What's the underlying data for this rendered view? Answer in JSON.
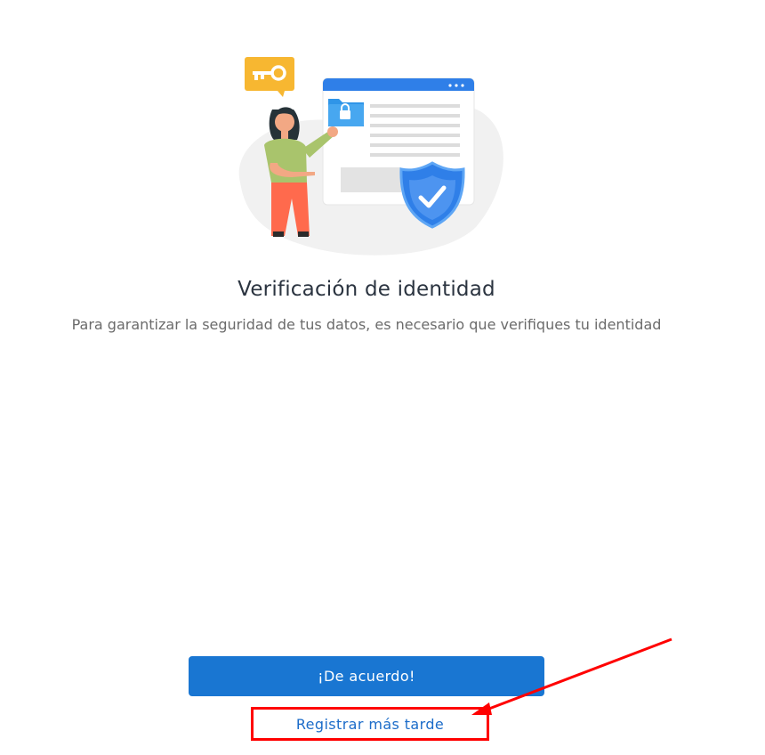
{
  "main": {
    "title": "Verificación de identidad",
    "subtitle": "Para garantizar la seguridad de tus datos, es necesario que verifiques tu identidad"
  },
  "actions": {
    "agree_label": "¡De acuerdo!",
    "later_label": "Registrar más tarde"
  },
  "colors": {
    "primary": "#1976d2",
    "link": "#1c6cc9",
    "annotation": "#ff0000"
  },
  "icons": [
    "key-icon",
    "folder-lock-icon",
    "shield-check-icon"
  ]
}
